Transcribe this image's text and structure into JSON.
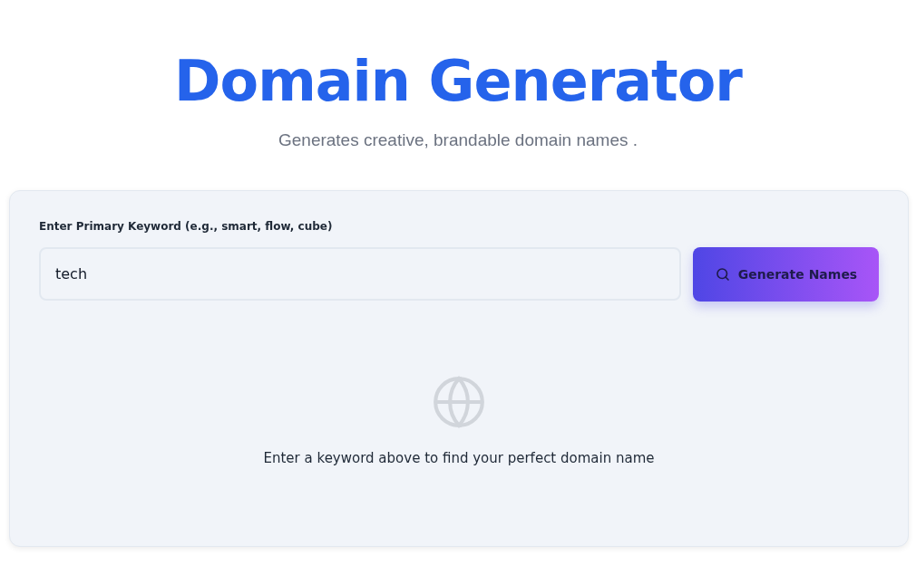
{
  "header": {
    "title": "Domain Generator",
    "subtitle": "Generates creative, brandable domain names ."
  },
  "form": {
    "label": "Enter Primary Keyword (e.g., smart, flow, cube)",
    "value": "tech",
    "button": "Generate Names"
  },
  "empty_state": {
    "message": "Enter a keyword above to find your perfect domain name"
  }
}
